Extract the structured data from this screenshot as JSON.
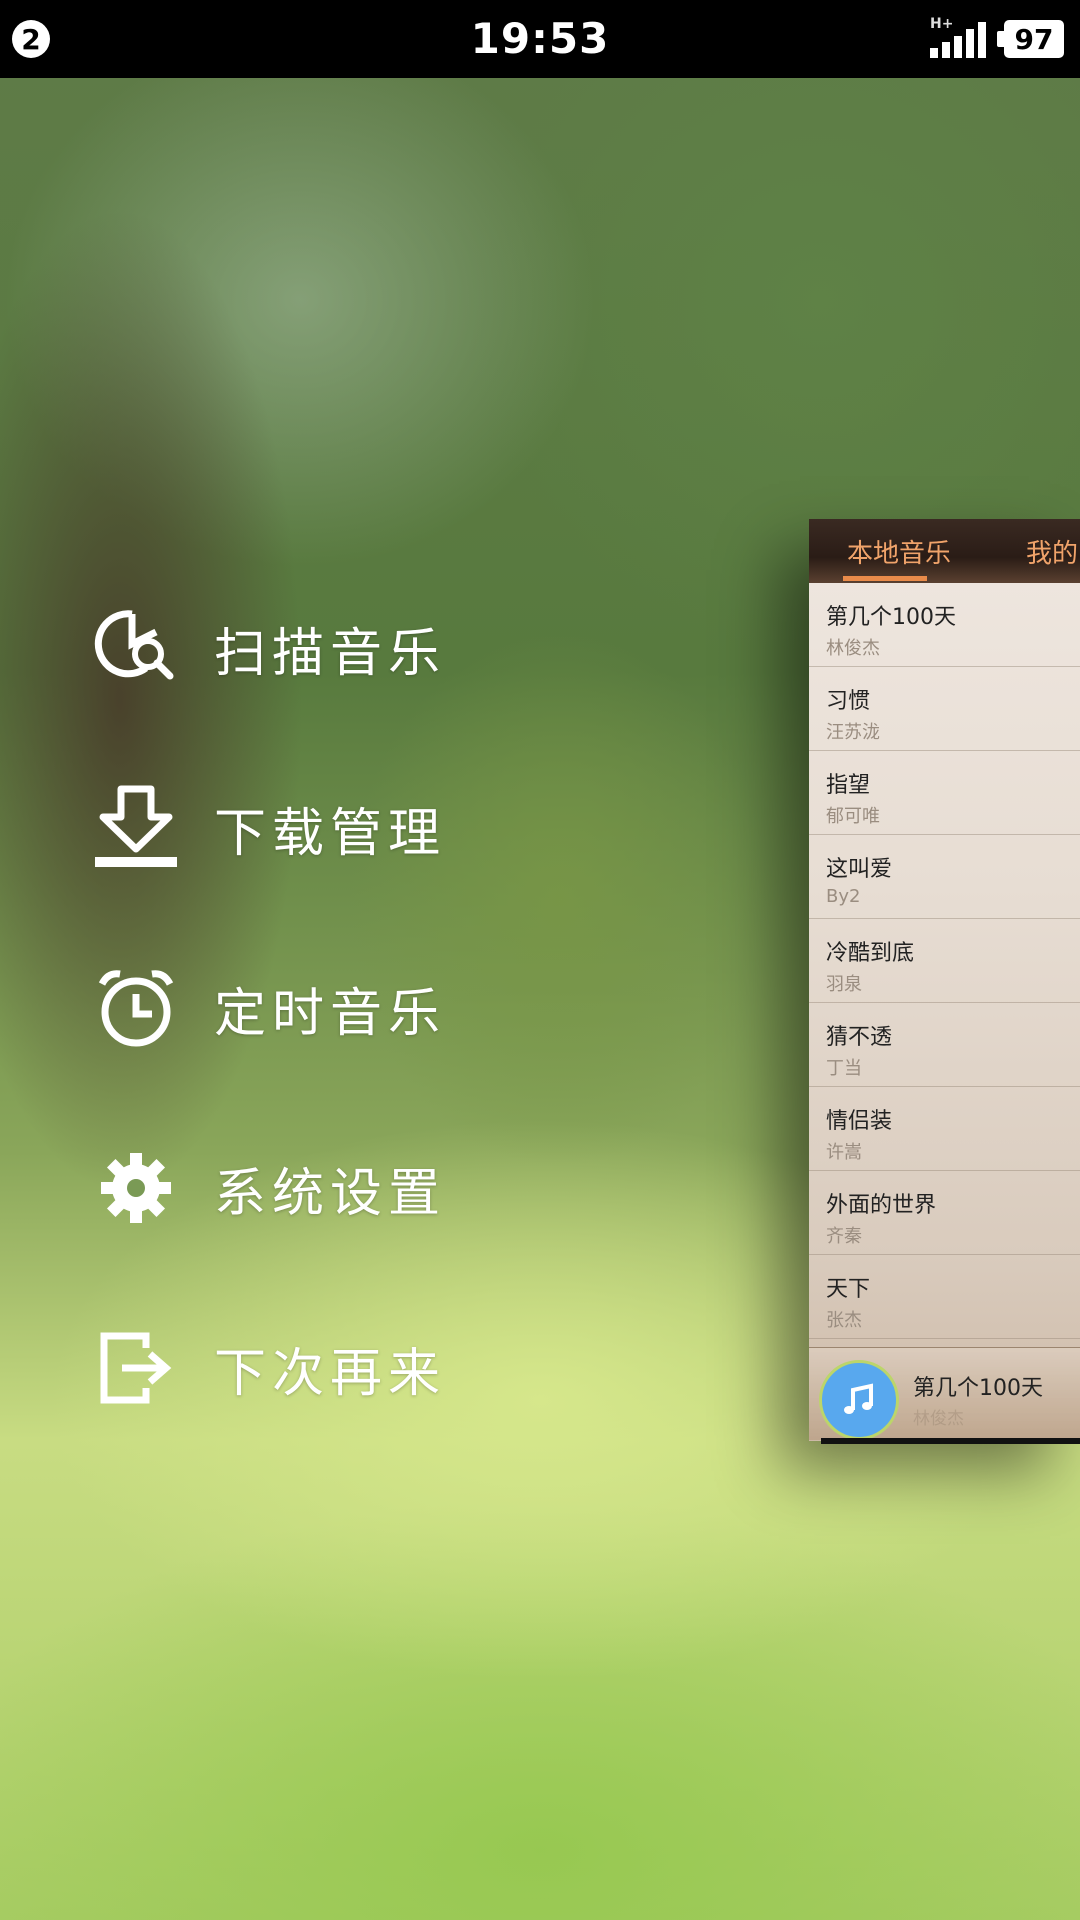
{
  "status_bar": {
    "notification_count": "2",
    "time": "19:53",
    "network_type": "H+",
    "battery_level": "97"
  },
  "drawer_menu": {
    "items": [
      {
        "label": "扫描音乐",
        "icon": "scan-music-icon"
      },
      {
        "label": "下载管理",
        "icon": "download-icon"
      },
      {
        "label": "定时音乐",
        "icon": "alarm-clock-icon"
      },
      {
        "label": "系统设置",
        "icon": "gear-icon"
      },
      {
        "label": "下次再来",
        "icon": "exit-icon"
      }
    ]
  },
  "main_panel": {
    "tabs": [
      {
        "label": "本地音乐",
        "active": true
      },
      {
        "label": "我的"
      }
    ],
    "songs": [
      {
        "title": "第几个100天",
        "artist": "林俊杰"
      },
      {
        "title": "习惯",
        "artist": "汪苏泷"
      },
      {
        "title": "指望",
        "artist": "郁可唯"
      },
      {
        "title": "这叫爱",
        "artist": "By2"
      },
      {
        "title": "冷酷到底",
        "artist": "羽泉"
      },
      {
        "title": "猜不透",
        "artist": "丁当"
      },
      {
        "title": "情侣装",
        "artist": "许嵩"
      },
      {
        "title": "外面的世界",
        "artist": "齐秦"
      },
      {
        "title": "天下",
        "artist": "张杰"
      }
    ],
    "now_playing": {
      "title": "第几个100天",
      "artist": "林俊杰"
    }
  },
  "colors": {
    "tab_accent": "#e98b4a",
    "player_disc": "#58a8ee"
  }
}
